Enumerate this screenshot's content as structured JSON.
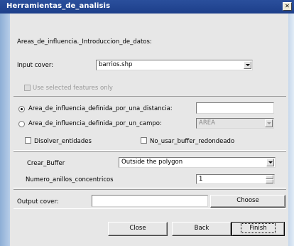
{
  "window": {
    "title": "Herramientas_de_analisis",
    "close_glyph": "✕"
  },
  "intro": {
    "text": "Areas_de_influencia._Introduccion_de_datos:"
  },
  "input_cover": {
    "label": "Input cover:",
    "value": "barrios.shp"
  },
  "use_selected": {
    "label": "Use selected features only"
  },
  "radio_distance": {
    "label": "Area_de_influencia_definida_por_una_distancia:",
    "value": ""
  },
  "radio_field": {
    "label": "Area_de_influencia_definida_por_un_campo:",
    "value": "AREA"
  },
  "disolver": {
    "label": "Disolver_entidades"
  },
  "no_redondeado": {
    "label": "No_usar_buffer_redondeado"
  },
  "crear_buffer": {
    "label": "Crear_Buffer",
    "value": "Outside the polygon"
  },
  "anillos": {
    "label": "Numero_anillos_concentricos",
    "value": "1"
  },
  "output_cover": {
    "label": "Output cover:",
    "value": "",
    "choose": "Choose"
  },
  "buttons": {
    "close": "Close",
    "back": "Back",
    "finish": "Finish"
  }
}
